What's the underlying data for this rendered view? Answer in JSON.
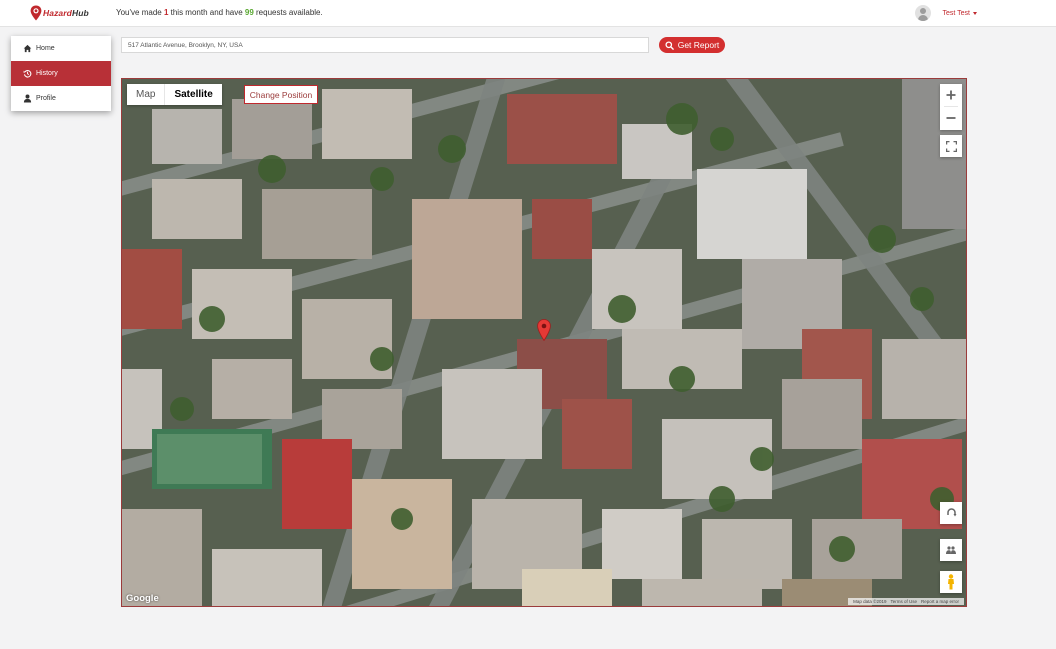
{
  "header": {
    "logo_text_hazard": "Hazard",
    "logo_text_hub": "Hub",
    "usage_prefix": "You've made ",
    "usage_used": "1",
    "usage_middle": " this month and have ",
    "usage_available": "99",
    "usage_suffix": " requests available.",
    "user_name": "Test Test"
  },
  "sidebar": {
    "items": [
      {
        "label": "Home",
        "icon": "home-icon"
      },
      {
        "label": "History",
        "icon": "history-icon",
        "active": true
      },
      {
        "label": "Profile",
        "icon": "user-icon"
      }
    ]
  },
  "search": {
    "value": "517 Atlantic Avenue, Brooklyn, NY, USA",
    "button_label": "Get Report"
  },
  "map": {
    "type_options": [
      "Map",
      "Satellite"
    ],
    "selected_type": "Satellite",
    "change_position_label": "Change Position",
    "google_label": "Google",
    "attribution": [
      "Map data ©2019",
      "Terms of Use",
      "Report a map error"
    ]
  },
  "colors": {
    "brand_red": "#c0282d",
    "active_nav": "#b83037",
    "available_green": "#5aa832"
  }
}
